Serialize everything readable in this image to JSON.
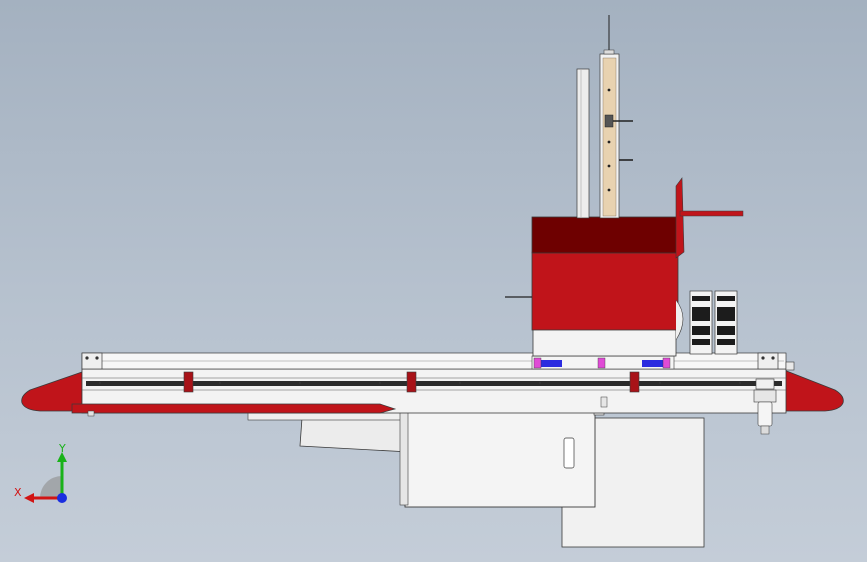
{
  "view": {
    "background_top": "#a4b1c0",
    "background_bottom": "#c4cdd8"
  },
  "colors": {
    "red": "#c0141a",
    "dark_red": "#6e0000",
    "light_gray": "#f1f1f1",
    "steel": "#d9d9d9",
    "outline": "#3a3a3a",
    "wood": "#e8d2b0",
    "blue": "#2b2be0",
    "magenta": "#e04bd6",
    "axis_x": "#d11414",
    "axis_y": "#19b219",
    "axis_z": "#1a2ee0"
  },
  "triad": {
    "x_label": "X",
    "y_label": "Y"
  }
}
